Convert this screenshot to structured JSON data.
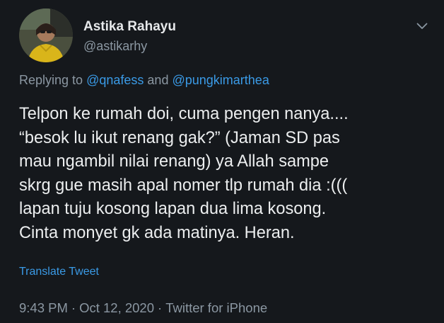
{
  "author": {
    "name": "Astika Rahayu",
    "handle": "@astikarhy"
  },
  "reply": {
    "prefix": "Replying to",
    "mention1": "@qnafess",
    "conjunction": "and",
    "mention2": "@pungkimarthea"
  },
  "tweet": {
    "lines": [
      "Telpon ke rumah doi, cuma pengen nanya....",
      "“besok lu ikut renang gak?” (Jaman SD pas",
      "mau ngambil nilai renang) ya Allah sampe",
      "skrg gue masih apal nomer tlp rumah dia :(((",
      "lapan tuju kosong lapan dua lima kosong.",
      "Cinta monyet gk ada matinya. Heran."
    ]
  },
  "translate_label": "Translate Tweet",
  "meta": {
    "time": "9:43 PM",
    "separator": "·",
    "date": "Oct 12, 2020",
    "source": "Twitter for iPhone"
  },
  "icons": {
    "menu": "chevron-down-icon",
    "avatar": "profile-photo"
  },
  "colors": {
    "background": "#15181c",
    "text": "#eceeef",
    "secondary": "#8b97a2",
    "accent": "#3a9ae6"
  }
}
